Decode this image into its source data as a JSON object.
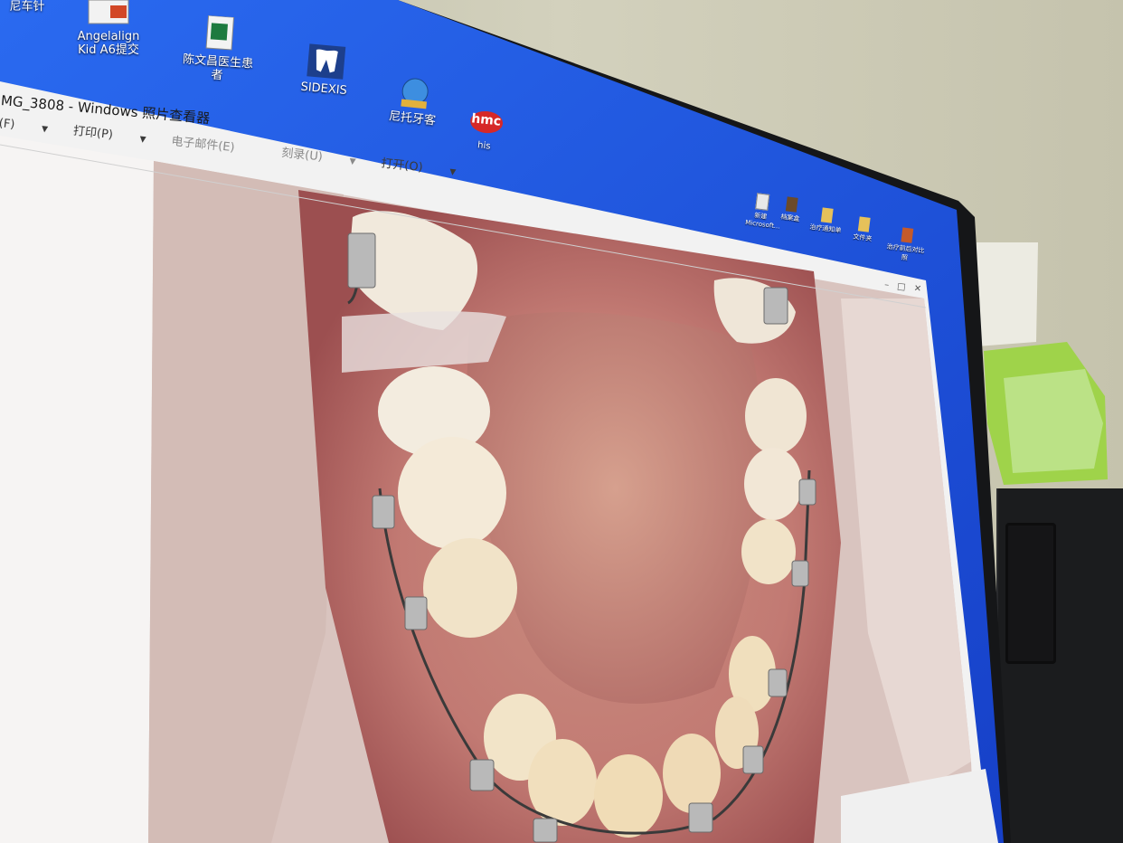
{
  "desktop": {
    "icons": [
      {
        "id": "top-left-partial",
        "label": "⁠尼车针"
      },
      {
        "id": "angelalign",
        "label": "Angelalign Kid A6提交"
      },
      {
        "id": "chen-patient",
        "label": "陈文昌医生患者"
      },
      {
        "id": "sidexis",
        "label": "SIDEXIS"
      },
      {
        "id": "nituo",
        "label": "尼托牙客"
      },
      {
        "id": "his",
        "label": "his",
        "badge": "hmc"
      }
    ],
    "tray_icons": [
      {
        "label": "新建 Microsoft..."
      },
      {
        "label": "档案盒"
      },
      {
        "label": "治疗通知单"
      },
      {
        "label": "文件夹"
      },
      {
        "label": "治疗前后对比照"
      }
    ]
  },
  "viewer": {
    "title": "MG_3808 - Windows 照片查看器",
    "menu": [
      {
        "label": "(F)",
        "enabled": true
      },
      {
        "label": "打印(P)",
        "enabled": true
      },
      {
        "label": "电子邮件(E)",
        "enabled": false
      },
      {
        "label": "刻录(U)",
        "enabled": false
      },
      {
        "label": "打开(O)",
        "enabled": true
      }
    ]
  },
  "colors": {
    "taskbar_blue": "#1a49d6",
    "wallpaper_blue": "#1f5de0",
    "window_white": "#f4f4f4"
  }
}
